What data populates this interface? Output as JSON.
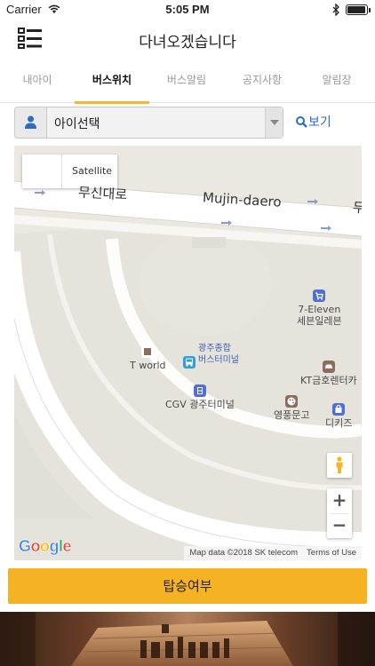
{
  "status_bar": {
    "carrier": "Carrier",
    "time": "5:05 PM",
    "battery_level": 0.95
  },
  "header": {
    "title": "다녀오겠습니다"
  },
  "tabs": [
    {
      "label": "내아이",
      "active": false
    },
    {
      "label": "버스위치",
      "active": true
    },
    {
      "label": "버스알림",
      "active": false
    },
    {
      "label": "공지사항",
      "active": false
    },
    {
      "label": "알림장",
      "active": false
    }
  ],
  "child_select": {
    "value": "아이선택"
  },
  "view_button": {
    "label": "보기"
  },
  "map": {
    "satellite_label": "Satellite",
    "roads": {
      "road_ko": "무신대로",
      "road_en": "Mujin-daero",
      "road_edge": "무"
    },
    "pois": {
      "seven_eleven_en": "7-Eleven",
      "seven_eleven_ko": "세븐일레븐",
      "t_world": "T world",
      "bus_terminal_1": "광주종합",
      "bus_terminal_2": "버스터미널",
      "kt_rental": "KT금호렌터카",
      "cgv": "CGV 광주터미널",
      "youngpoong": "영풍문고",
      "dikids": "디키즈"
    },
    "zoom_in": "+",
    "zoom_out": "−",
    "logo": [
      "G",
      "o",
      "o",
      "g",
      "l",
      "e"
    ],
    "attribution": "Map data ©2018 SK telecom",
    "terms": "Terms of Use",
    "colors": {
      "road": "#ffffff",
      "land": "#ebe8e2",
      "poi_grey": "#8a6d5e",
      "poi_blue": "#4f6fd1"
    }
  },
  "board_button": {
    "label": "탑승여부"
  },
  "colors": {
    "accent": "#f5b324",
    "tab_indicator": "#f5b82e",
    "link": "#2b6cc4"
  }
}
